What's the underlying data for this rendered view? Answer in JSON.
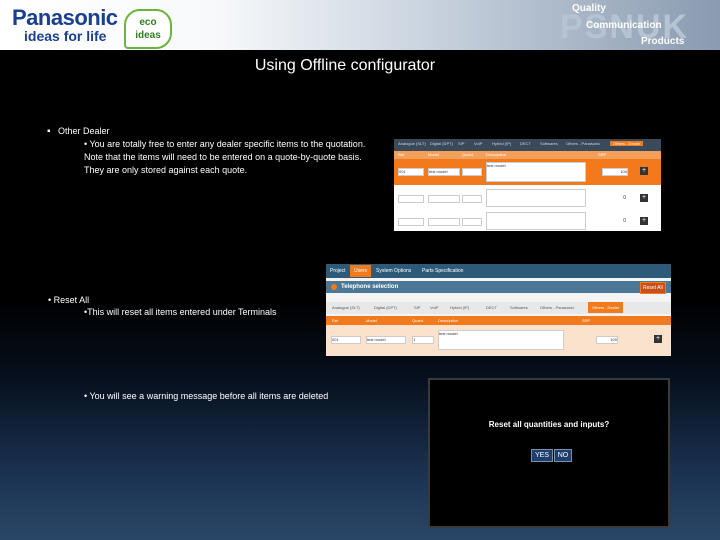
{
  "header": {
    "brand": "Panasonic",
    "tagline": "ideas for life",
    "eco_line1": "eco",
    "eco_line2": "ideas",
    "psnuk": "PSNUK",
    "quality": "Quality",
    "communication": "Communication",
    "products": "Products"
  },
  "title": "Using Offline configurator",
  "bullets": {
    "other_dealer": "Other Dealer",
    "other_dealer_sub": "• You are totally free to enter any dealer specific items to the quotation. Note that the items will need to be entered on a quote-by-quote basis. They are only stored against each quote.",
    "reset_all": "• Reset All",
    "reset_all_sub": "•This will reset all items entered under Terminals",
    "warning": "• You will see a warning message before all items are deleted"
  },
  "shot1": {
    "tabs": [
      "Analogue (SLT)",
      "Digital (DPT)",
      "SIP",
      "VoIP",
      "Hybrid (IP)",
      "DECT",
      "Softwares",
      "Others - Panasonic",
      "Others - Dealer"
    ],
    "columns": [
      "Ref",
      "Model",
      "Quant.",
      "Description",
      "SRP"
    ],
    "row1": {
      "ref": "001",
      "model": "test model",
      "quant": "",
      "description": "test model",
      "srp": "100"
    },
    "row2": {
      "quant": "0"
    },
    "row3": {
      "quant": "0"
    }
  },
  "shot2": {
    "tabs": [
      "Project",
      "Users",
      "System Options",
      "Parts Specification"
    ],
    "section": "Telephone selection",
    "reset_button": "Reset All",
    "subtabs": [
      "Analogue (SLT)",
      "Digital (DPT)",
      "SIP",
      "VoIP",
      "Hybrid (IP)",
      "DECT",
      "Softwares",
      "Others - Panasonic",
      "Others - Dealer"
    ],
    "columns": [
      "Ref",
      "Model",
      "Quant.",
      "Description",
      "SRP"
    ],
    "row": {
      "ref": "001",
      "model": "test model",
      "quant": "1",
      "description": "test model",
      "srp": "100"
    }
  },
  "dialog": {
    "message": "Reset all quantities and inputs?",
    "yes": "YES",
    "no": "NO"
  }
}
